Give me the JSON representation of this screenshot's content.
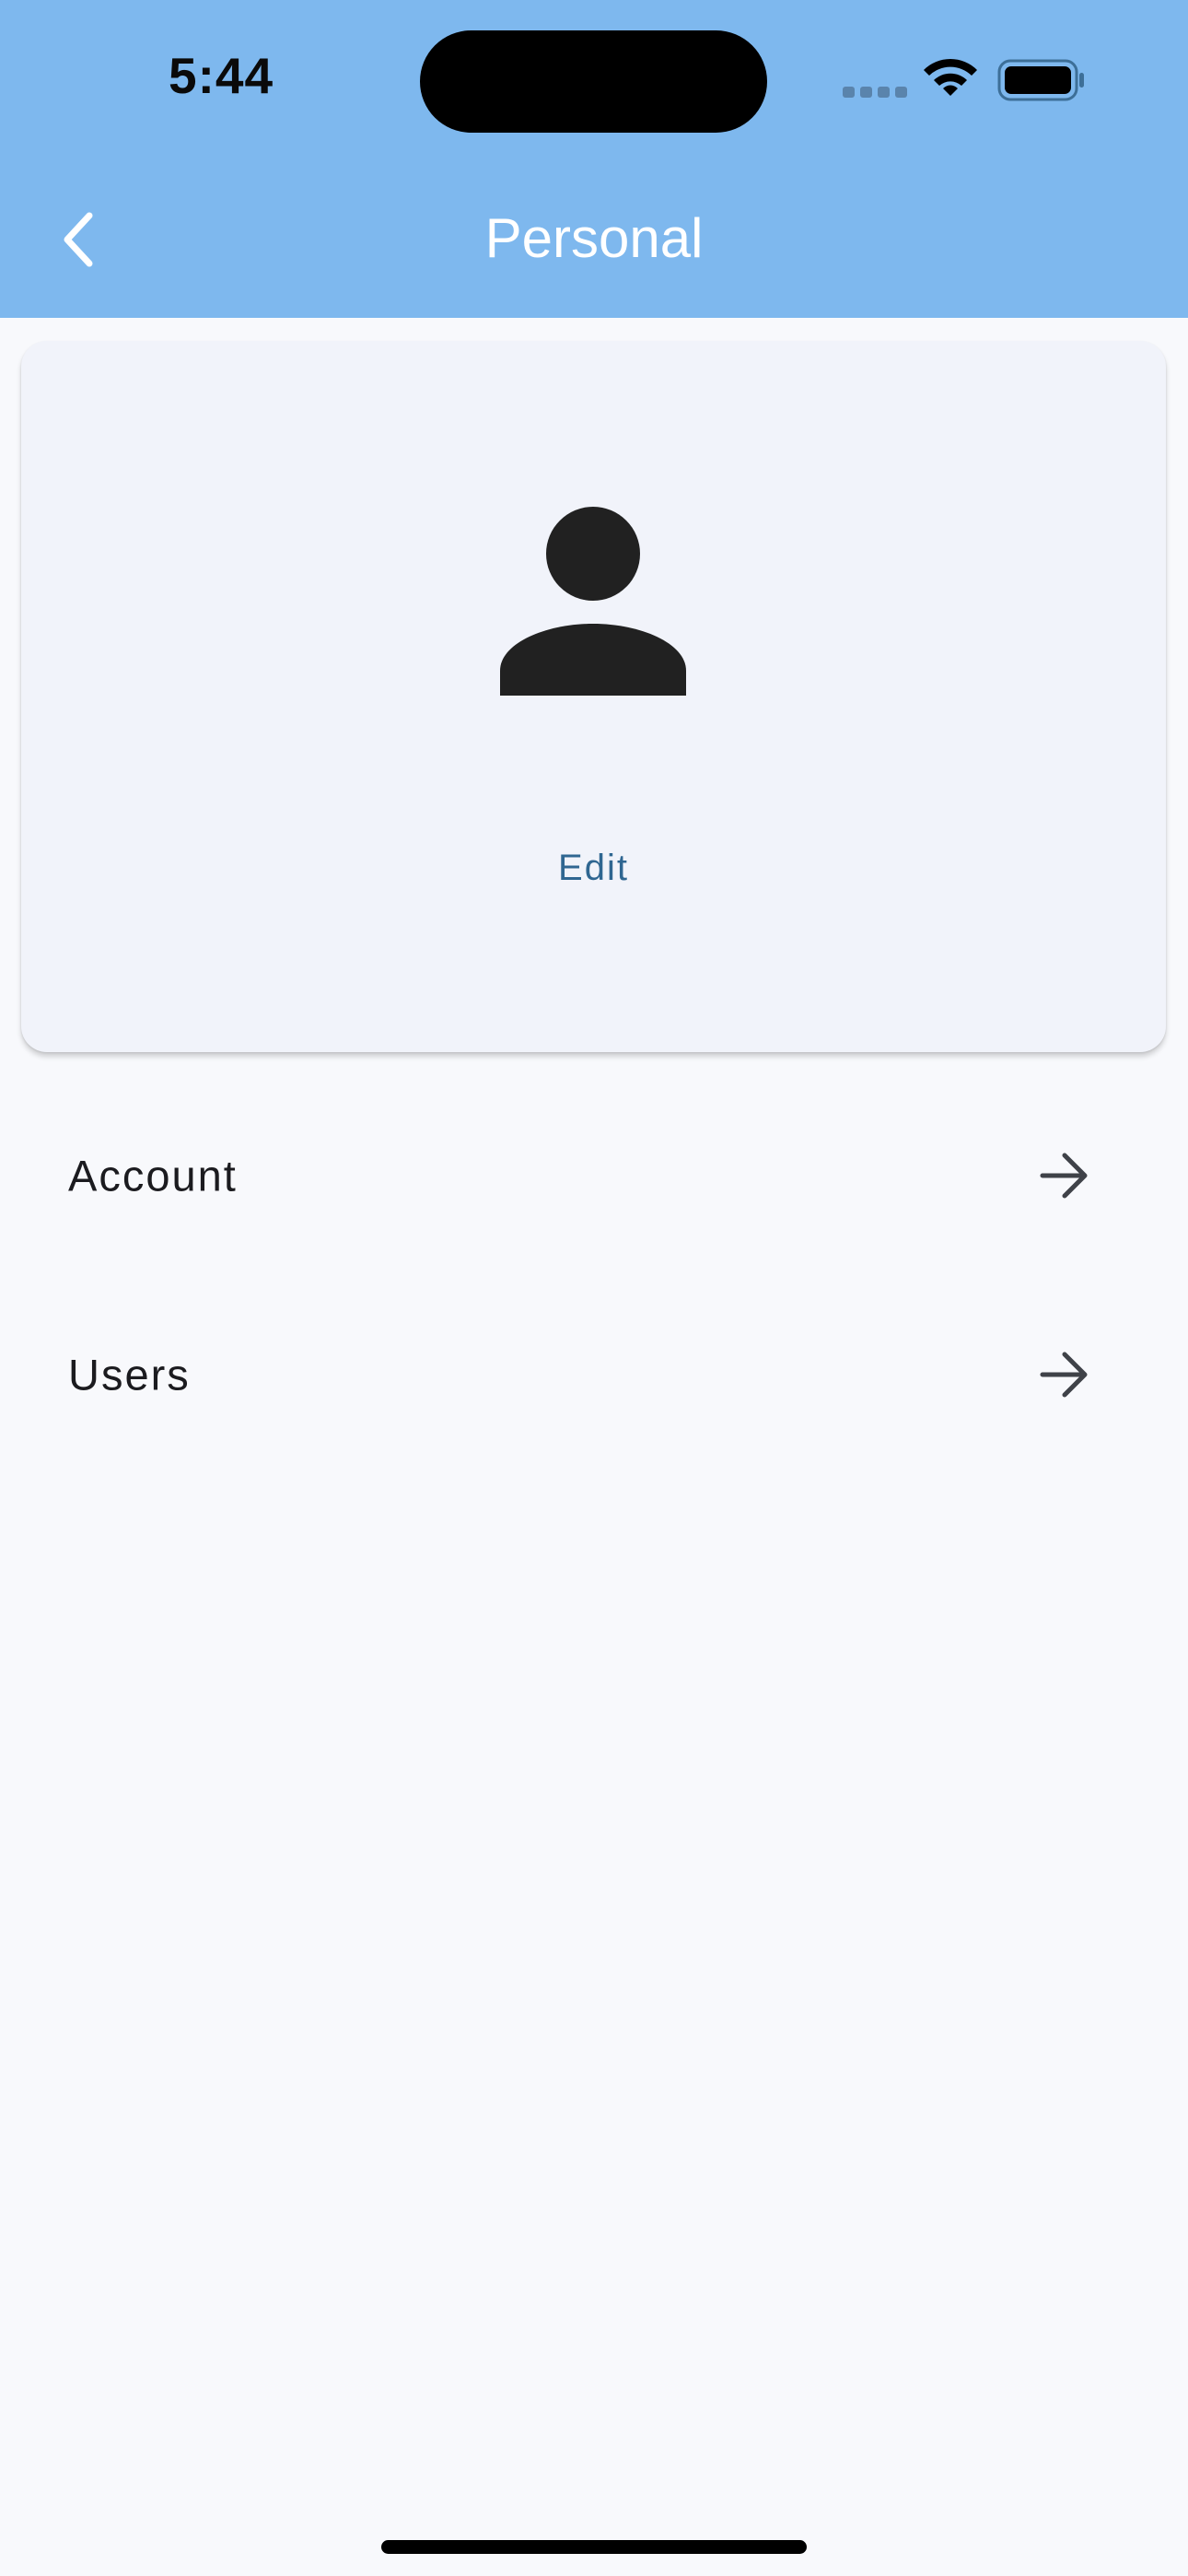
{
  "status_bar": {
    "time": "5:44"
  },
  "header": {
    "title": "Personal",
    "background_color": "#7eb8ee",
    "back_icon": "chevron-left-icon"
  },
  "profile_card": {
    "avatar_icon": "person-icon",
    "edit_label": "Edit",
    "accent_color": "#2f6691"
  },
  "menu": {
    "items": [
      {
        "label": "Account",
        "icon": "arrow-right-icon"
      },
      {
        "label": "Users",
        "icon": "arrow-right-icon"
      }
    ]
  }
}
